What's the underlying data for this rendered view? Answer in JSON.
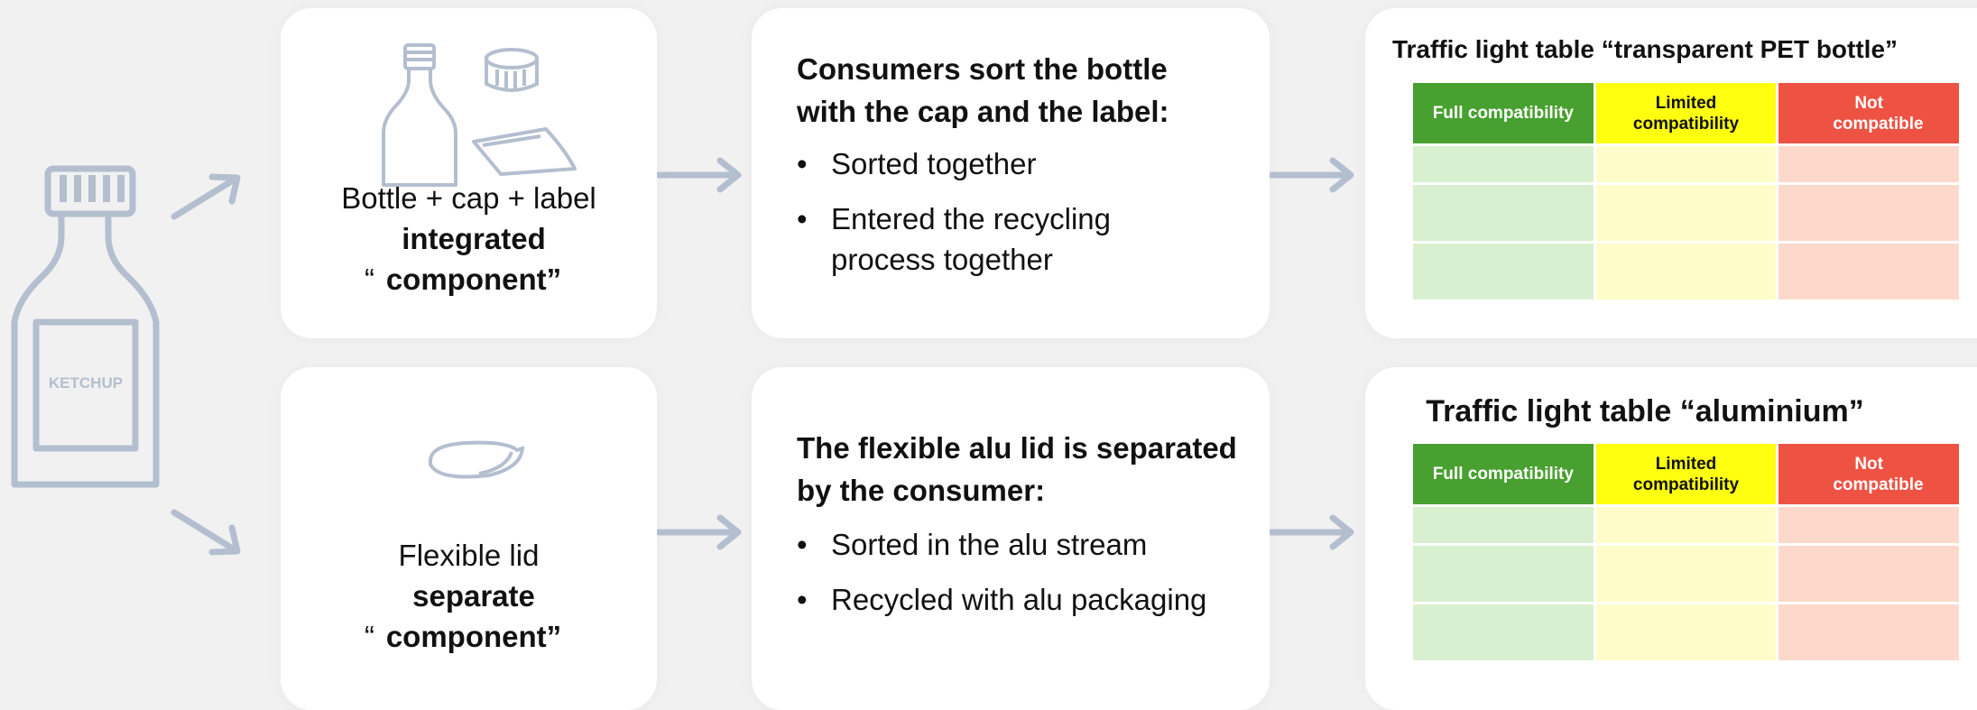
{
  "colors": {
    "icon": "#b3bfcf",
    "full": "#47a02f",
    "limited": "#ffff10",
    "not": "#ee5243",
    "full_light": "#d8f0cf",
    "limited_light": "#fefdc9",
    "not_light": "#fdd9cc"
  },
  "bottle_icon": {
    "label": "KETCHUP"
  },
  "rows": [
    {
      "component": {
        "line1": "Bottle + cap + label",
        "open_quote": "“",
        "bold": "integrated component”",
        "icons": [
          "bottle-icon",
          "cap-icon",
          "label-icon"
        ]
      },
      "process": {
        "title": "Consumers sort the bottle with the cap and the label:",
        "bullets": [
          "Sorted together",
          "Entered the recycling process together"
        ]
      },
      "traffic_table": {
        "title": "Traffic light table “transparent PET bottle”",
        "headers": [
          "Full compatibility",
          "Limited compatibility",
          "Not compatible"
        ]
      }
    },
    {
      "component": {
        "line1": "Flexible lid",
        "open_quote": "“",
        "bold": "separate component”",
        "icons": [
          "lid-icon"
        ]
      },
      "process": {
        "title": "The flexible alu lid is separated by the consumer:",
        "bullets": [
          "Sorted in the alu stream",
          "Recycled with alu packaging"
        ]
      },
      "traffic_table": {
        "title": "Traffic light table “aluminium”",
        "headers": [
          "Full compatibility",
          "Limited compatibility",
          "Not compatible"
        ]
      }
    }
  ]
}
